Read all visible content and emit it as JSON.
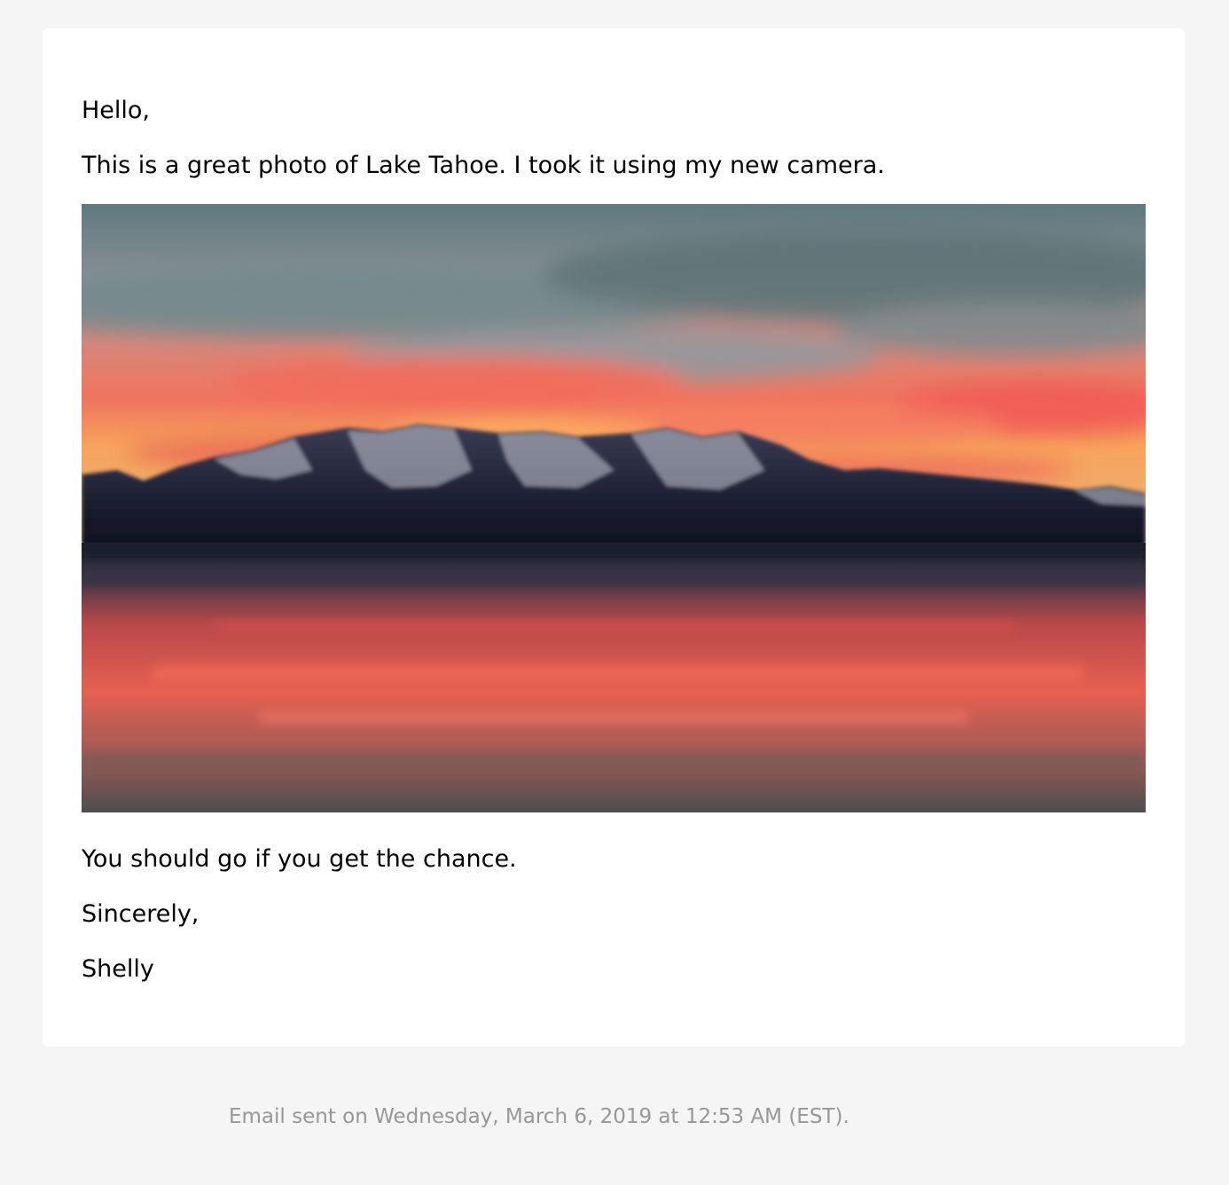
{
  "email": {
    "greeting": "Hello,",
    "intro": "This is a great photo of Lake Tahoe. I took it using my new camera.",
    "photo": {
      "subject": "Lake Tahoe sunset with snow-capped mountains reflected in the water"
    },
    "recommendation": "You should go if you get the chance.",
    "closing": "Sincerely,",
    "signature": "Shelly"
  },
  "footer": {
    "sent_text": "Email sent on Wednesday, March 6, 2019 at 12:53 AM (EST)."
  },
  "colors": {
    "page_background": "#f5f5f5",
    "card_background": "#ffffff",
    "body_text": "#000000",
    "footer_text": "#979797"
  }
}
